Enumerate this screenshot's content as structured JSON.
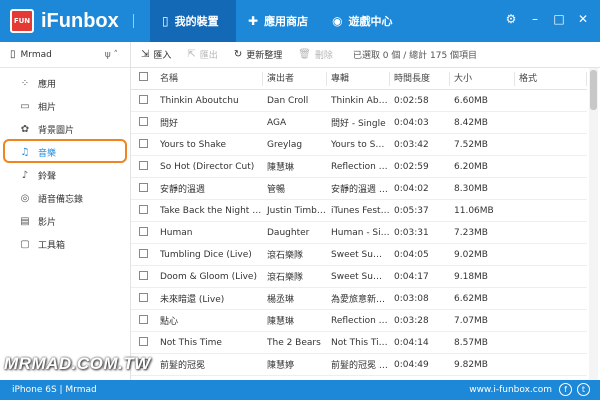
{
  "app": {
    "name": "iFunbox",
    "logo_text": "FUN"
  },
  "nav": [
    {
      "label": "我的裝置",
      "icon": "phone-icon"
    },
    {
      "label": "應用商店",
      "icon": "puzzle-icon"
    },
    {
      "label": "遊戲中心",
      "icon": "gamepad-icon"
    }
  ],
  "device": {
    "name": "Mrmad"
  },
  "sidebar": {
    "items": [
      {
        "label": "應用",
        "icon": "apps-icon"
      },
      {
        "label": "相片",
        "icon": "photo-icon"
      },
      {
        "label": "背景圖片",
        "icon": "wallpaper-icon"
      },
      {
        "label": "音樂",
        "icon": "music-icon"
      },
      {
        "label": "鈴聲",
        "icon": "bell-icon"
      },
      {
        "label": "語音備忘錄",
        "icon": "voice-memo-icon"
      },
      {
        "label": "影片",
        "icon": "video-icon"
      },
      {
        "label": "工具箱",
        "icon": "toolbox-icon"
      }
    ]
  },
  "toolbar": {
    "import": "匯入",
    "export": "匯出",
    "refresh": "更新整理",
    "delete": "刪除",
    "info": "已選取 0 個 / 總計 175 個項目"
  },
  "table": {
    "headers": [
      "名稱",
      "演出者",
      "專輯",
      "時間長度",
      "大小",
      "格式"
    ],
    "rows": [
      [
        "Thinkin Aboutchu",
        "Dan Croll",
        "Thinkin Abo…",
        "0:02:58",
        "6.60MB",
        ""
      ],
      [
        "問好",
        "AGA",
        "問好 - Single",
        "0:04:03",
        "8.42MB",
        ""
      ],
      [
        "Yours to Shake",
        "Greylag",
        "Yours to Sha…",
        "0:03:42",
        "7.52MB",
        ""
      ],
      [
        "So Hot (Director Cut)",
        "陳慧琳",
        "Reflection II-…",
        "0:02:59",
        "6.20MB",
        ""
      ],
      [
        "安靜的溫週",
        "管暢",
        "安靜的溫週 -…",
        "0:04:02",
        "8.30MB",
        ""
      ],
      [
        "Take Back the Night (Li…",
        "Justin Timb…",
        "iTunes Festi…",
        "0:05:37",
        "11.06MB",
        ""
      ],
      [
        "Human",
        "Daughter",
        "Human - Si…",
        "0:03:31",
        "7.23MB",
        ""
      ],
      [
        "Tumbling Dice (Live)",
        "滾石樂隊",
        "Sweet Sum…",
        "0:04:05",
        "9.02MB",
        ""
      ],
      [
        "Doom & Gloom (Live)",
        "滾石樂隊",
        "Sweet Sum…",
        "0:04:17",
        "9.18MB",
        ""
      ],
      [
        "未來暗還 (Live)",
        "楊丞琳",
        "為愛旅意新年…",
        "0:03:08",
        "6.62MB",
        ""
      ],
      [
        "點心",
        "陳慧琳",
        "Reflection II-…",
        "0:03:28",
        "7.07MB",
        ""
      ],
      [
        "Not This Time",
        "The 2 Bears",
        "Not This Ti…",
        "0:04:14",
        "8.57MB",
        ""
      ],
      [
        "前髮的冠冕",
        "陳慧婷",
        "前髮的冠冕 -…",
        "0:04:49",
        "9.82MB",
        ""
      ]
    ]
  },
  "watermark": "MRMAD.COM.TW",
  "footer": {
    "device_info": "iPhone 6S | Mrmad",
    "website": "www.i-funbox.com",
    "social": [
      "f",
      "t"
    ]
  },
  "colors": {
    "accent": "#1e88d8",
    "active_nav": "#1469b6",
    "highlight": "#f28222"
  }
}
